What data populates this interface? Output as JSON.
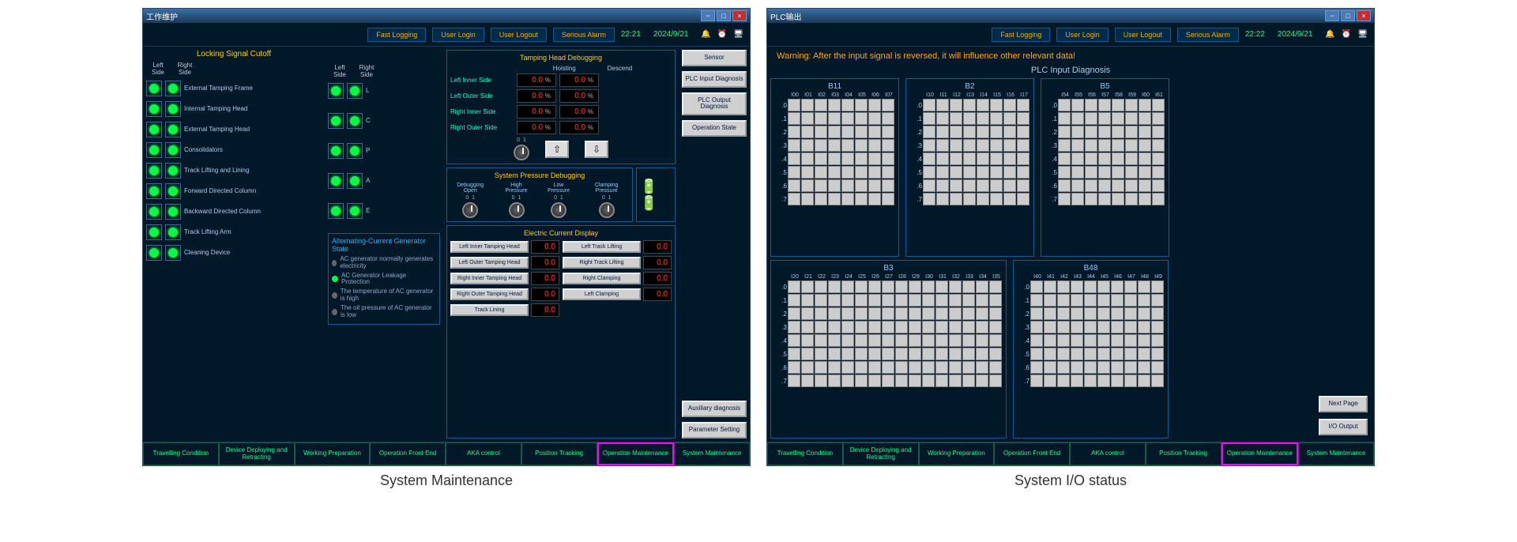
{
  "titles": {
    "win1": "工作维护",
    "win2": "PLC输出"
  },
  "time": {
    "t1": "22:21",
    "t2": "22:22",
    "date": "2024/9/21"
  },
  "topbuttons": [
    "Fast Logging",
    "User Login",
    "User Logout",
    "Serious Alarm"
  ],
  "botnav": [
    "Travelling Condition",
    "Device Deploying and Retracting",
    "Working Preparation",
    "Operation Front End",
    "AKA control",
    "Position Tracking",
    "Operation Maintenance",
    "System Maintenance"
  ],
  "captions": {
    "c1": "System Maintenance",
    "c2": "System I/O status"
  },
  "locking": {
    "title": "Locking Signal Cutoff",
    "hdrs": {
      "ls": "Left Side",
      "rs": "Right Side"
    },
    "items": [
      "External Tamping Frame",
      "Internal Tamping Head",
      "External Tamping Head",
      "Consolidators",
      "Track Lifting and Lining",
      "Forward Directed Column",
      "Backward Directed Column",
      "Track Lifting Arm",
      "Cleaning Device"
    ],
    "midlabels": [
      "L",
      "C",
      "P",
      "A",
      "E"
    ]
  },
  "gen": {
    "title": "Alternating-Current Generator State",
    "items": [
      "AC generator normally generates electricity",
      "AC Generator Leakage Protection",
      "The temperature of AC generator is high",
      "The oil pressure of AC generator is low"
    ]
  },
  "tamping": {
    "title": "Tamping Head Debugging",
    "hoist": "Hoisting",
    "descend": "Descend",
    "rows": [
      "Left Inner Side",
      "Left Outer Side",
      "Right Inner Side",
      "Right Outer Side"
    ],
    "val": "0.0",
    "unit": "%"
  },
  "syspress": {
    "title": "System Pressure Debugging",
    "knobs": [
      "Debugging Open",
      "High Pressure",
      "Low Pressure",
      "Clamping Pressure"
    ]
  },
  "electric": {
    "title": "Electric Current Display",
    "left": [
      "Left Inner Tamping Head",
      "Left Outer Tamping Head",
      "Right Inner Tamping Head",
      "Right Outer Tamping Head",
      "Track Lining"
    ],
    "right": [
      "Left Track Lifting",
      "Right Track Lifting",
      "Right Clamping",
      "Left Clamping"
    ],
    "val": "0.0"
  },
  "rbtns": [
    "Sensor",
    "PLC Input Diagnosis",
    "PLC Output Diagnosis",
    "Operation State",
    "Auxiliary diagnosis",
    "Parameter Setting"
  ],
  "plc": {
    "warning": "Warning: After the input signal is reversed, it will influence other relevant data!",
    "title": "PLC Input Diagnosis",
    "blocks": {
      "B11": {
        "cols": [
          "I00",
          "I01",
          "I02",
          "I03",
          "I04",
          "I05",
          "I06",
          "I07"
        ]
      },
      "B2": {
        "cols": [
          "I10",
          "I11",
          "I12",
          "I13",
          "I14",
          "I15",
          "I16",
          "I17"
        ]
      },
      "B5": {
        "cols": [
          "I54",
          "I55",
          "I56",
          "I57",
          "I58",
          "I59",
          "I60",
          "I61"
        ]
      },
      "B3": {
        "cols": [
          "I20",
          "I21",
          "I22",
          "I23",
          "I24",
          "I25",
          "I26",
          "I27",
          "I28",
          "I29",
          "I30",
          "I31",
          "I32",
          "I33",
          "I34",
          "I35"
        ]
      },
      "B48": {
        "cols": [
          "I40",
          "I41",
          "I42",
          "I43",
          "I44",
          "I45",
          "I46",
          "I47",
          "I48",
          "I49"
        ]
      }
    },
    "rows": [
      ".0",
      ".1",
      ".2",
      ".3",
      ".4",
      ".5",
      ".6",
      ".7"
    ],
    "buttons": {
      "next": "Next Page",
      "io": "I/O Output"
    }
  }
}
